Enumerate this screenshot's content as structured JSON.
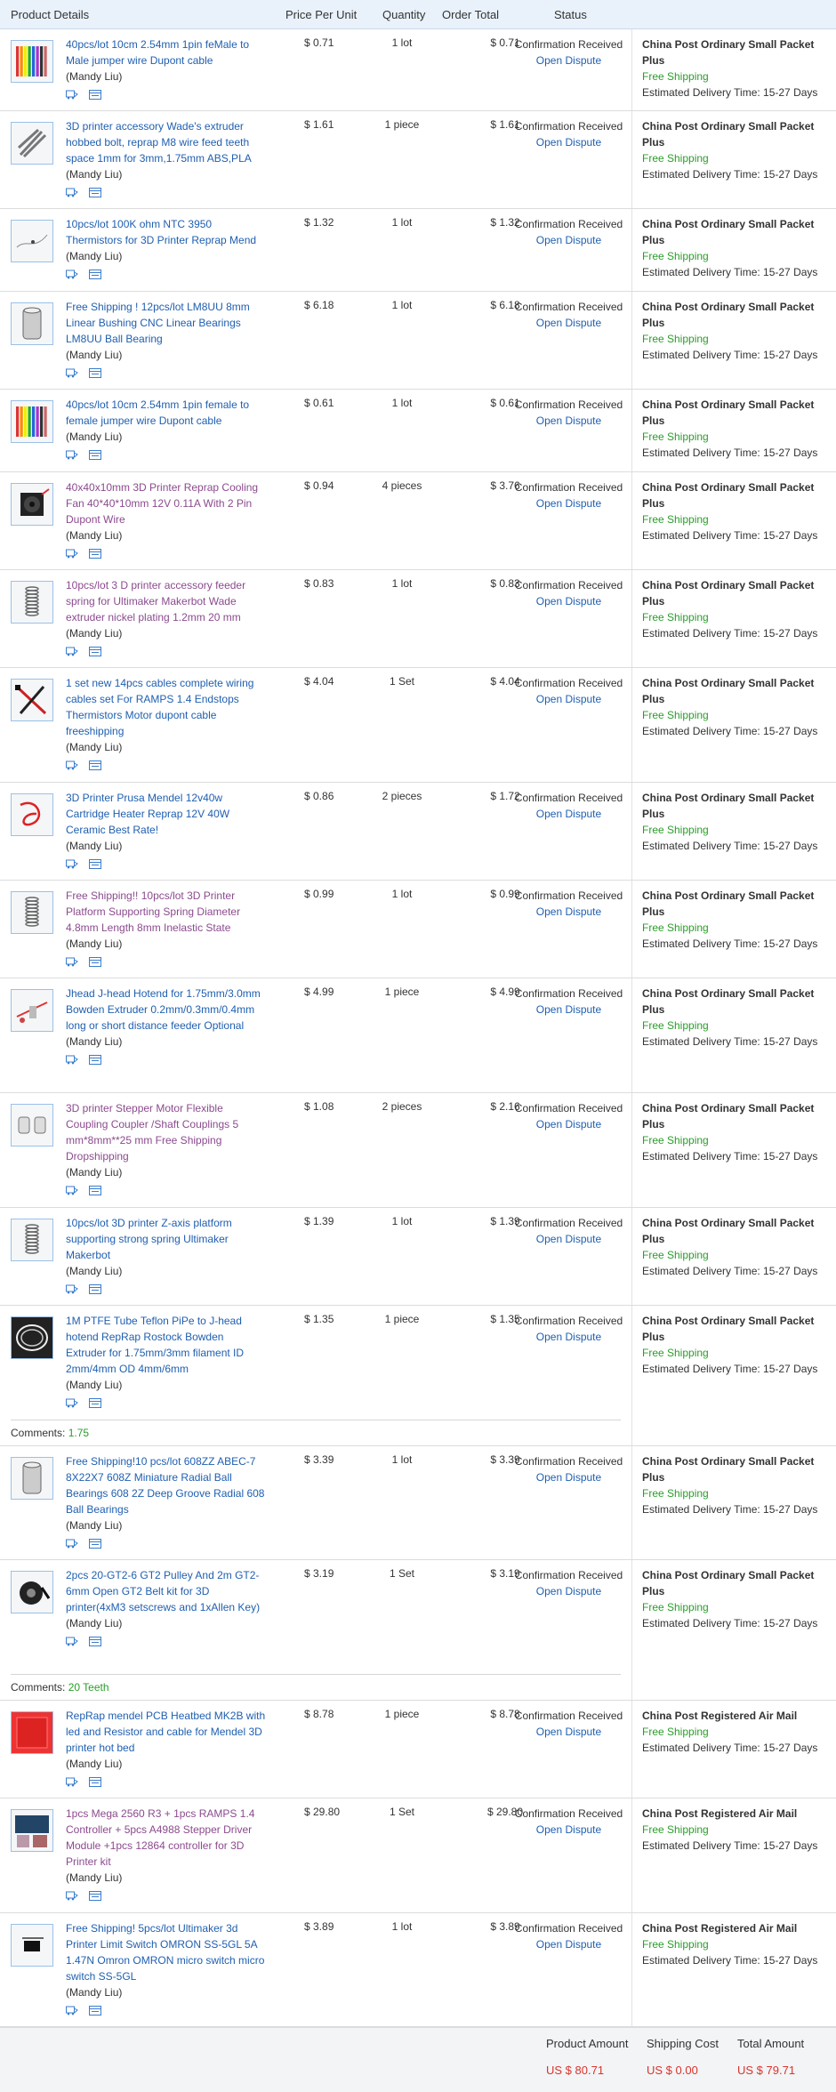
{
  "header": {
    "product_details": "Product Details",
    "price_per_unit": "Price Per Unit",
    "quantity": "Quantity",
    "order_total": "Order Total",
    "status": "Status"
  },
  "orders": [
    {
      "title": "40pcs/lot 10cm 2.54mm 1pin feMale to Male jumper wire Dupont cable",
      "seller": "(Mandy Liu)",
      "price": "$ 0.71",
      "qty": "1 lot",
      "total": "$ 0.71",
      "status": "Confirmation Received",
      "dispute": "Open Dispute",
      "ship_method": "China Post Ordinary Small Packet Plus",
      "ship_cost": "Free Shipping",
      "delivery": "Estimated Delivery Time: 15-27 Days"
    },
    {
      "title": "3D printer accessory Wade's extruder hobbed bolt, reprap M8 wire feed teeth space 1mm for 3mm,1.75mm ABS,PLA",
      "seller": "(Mandy Liu)",
      "price": "$ 1.61",
      "qty": "1 piece",
      "total": "$ 1.61",
      "status": "Confirmation Received",
      "dispute": "Open Dispute",
      "ship_method": "China Post Ordinary Small Packet Plus",
      "ship_cost": "Free Shipping",
      "delivery": "Estimated Delivery Time: 15-27 Days"
    },
    {
      "title": "10pcs/lot 100K ohm NTC 3950 Thermistors for 3D Printer Reprap Mend",
      "seller": "(Mandy Liu)",
      "price": "$ 1.32",
      "qty": "1 lot",
      "total": "$ 1.32",
      "status": "Confirmation Received",
      "dispute": "Open Dispute",
      "ship_method": "China Post Ordinary Small Packet Plus",
      "ship_cost": "Free Shipping",
      "delivery": "Estimated Delivery Time: 15-27 Days"
    },
    {
      "title": "Free Shipping ! 12pcs/lot LM8UU 8mm Linear Bushing CNC Linear Bearings LM8UU Ball Bearing",
      "seller": "(Mandy Liu)",
      "price": "$ 6.18",
      "qty": "1 lot",
      "total": "$ 6.18",
      "status": "Confirmation Received",
      "dispute": "Open Dispute",
      "ship_method": "China Post Ordinary Small Packet Plus",
      "ship_cost": "Free Shipping",
      "delivery": "Estimated Delivery Time: 15-27 Days"
    },
    {
      "title": "40pcs/lot 10cm 2.54mm 1pin female to female jumper wire Dupont cable",
      "seller": "(Mandy Liu)",
      "price": "$ 0.61",
      "qty": "1 lot",
      "total": "$ 0.61",
      "status": "Confirmation Received",
      "dispute": "Open Dispute",
      "ship_method": "China Post Ordinary Small Packet Plus",
      "ship_cost": "Free Shipping",
      "delivery": "Estimated Delivery Time: 15-27 Days"
    },
    {
      "title": "40x40x10mm 3D Printer Reprap Cooling Fan 40*40*10mm 12V 0.11A With 2 Pin Dupont Wire",
      "seller": "(Mandy Liu)",
      "price": "$ 0.94",
      "qty": "4 pieces",
      "total": "$ 3.76",
      "status": "Confirmation Received",
      "dispute": "Open Dispute",
      "ship_method": "China Post Ordinary Small Packet Plus",
      "ship_cost": "Free Shipping",
      "delivery": "Estimated Delivery Time: 15-27 Days"
    },
    {
      "title": "10pcs/lot 3 D printer accessory feeder spring for Ultimaker Makerbot Wade extruder nickel plating 1.2mm 20 mm",
      "seller": "(Mandy Liu)",
      "price": "$ 0.83",
      "qty": "1 lot",
      "total": "$ 0.83",
      "status": "Confirmation Received",
      "dispute": "Open Dispute",
      "ship_method": "China Post Ordinary Small Packet Plus",
      "ship_cost": "Free Shipping",
      "delivery": "Estimated Delivery Time: 15-27 Days"
    },
    {
      "title": "1 set new 14pcs cables complete wiring cables set For RAMPS 1.4 Endstops Thermistors Motor dupont cable freeshipping",
      "seller": "(Mandy Liu)",
      "price": "$ 4.04",
      "qty": "1 Set",
      "total": "$ 4.04",
      "status": "Confirmation Received",
      "dispute": "Open Dispute",
      "ship_method": "China Post Ordinary Small Packet Plus",
      "ship_cost": "Free Shipping",
      "delivery": "Estimated Delivery Time: 15-27 Days"
    },
    {
      "title": "3D Printer Prusa Mendel 12v40w Cartridge Heater Reprap 12V 40W Ceramic Best Rate!",
      "seller": "(Mandy Liu)",
      "price": "$ 0.86",
      "qty": "2 pieces",
      "total": "$ 1.72",
      "status": "Confirmation Received",
      "dispute": "Open Dispute",
      "ship_method": "China Post Ordinary Small Packet Plus",
      "ship_cost": "Free Shipping",
      "delivery": "Estimated Delivery Time: 15-27 Days"
    },
    {
      "title": "Free Shipping!! 10pcs/lot 3D Printer Platform Supporting Spring Diameter 4.8mm Length 8mm Inelastic State",
      "seller": "(Mandy Liu)",
      "price": "$ 0.99",
      "qty": "1 lot",
      "total": "$ 0.99",
      "status": "Confirmation Received",
      "dispute": "Open Dispute",
      "ship_method": "China Post Ordinary Small Packet Plus",
      "ship_cost": "Free Shipping",
      "delivery": "Estimated Delivery Time: 15-27 Days"
    },
    {
      "title": "Jhead J-head Hotend for 1.75mm/3.0mm Bowden Extruder 0.2mm/0.3mm/0.4mm long or short distance feeder Optional",
      "seller": "(Mandy Liu)",
      "price": "$ 4.99",
      "qty": "1 piece",
      "total": "$ 4.99",
      "status": "Confirmation Received",
      "dispute": "Open Dispute",
      "ship_method": "China Post Ordinary Small Packet Plus",
      "ship_cost": "Free Shipping",
      "delivery": "Estimated Delivery Time: 15-27 Days"
    },
    {
      "title": "3D printer Stepper Motor Flexible Coupling Coupler /Shaft Couplings 5 mm*8mm**25 mm Free Shipping Dropshipping",
      "seller": "(Mandy Liu)",
      "price": "$ 1.08",
      "qty": "2 pieces",
      "total": "$ 2.16",
      "status": "Confirmation Received",
      "dispute": "Open Dispute",
      "ship_method": "China Post Ordinary Small Packet Plus",
      "ship_cost": "Free Shipping",
      "delivery": "Estimated Delivery Time: 15-27 Days"
    },
    {
      "title": "10pcs/lot 3D printer Z-axis platform supporting strong spring Ultimaker Makerbot",
      "seller": "(Mandy Liu)",
      "price": "$ 1.39",
      "qty": "1 lot",
      "total": "$ 1.39",
      "status": "Confirmation Received",
      "dispute": "Open Dispute",
      "ship_method": "China Post Ordinary Small Packet Plus",
      "ship_cost": "Free Shipping",
      "delivery": "Estimated Delivery Time: 15-27 Days"
    },
    {
      "title": "1M PTFE Tube Teflon PiPe to J-head hotend RepRap Rostock Bowden Extruder for 1.75mm/3mm filament ID 2mm/4mm OD 4mm/6mm",
      "seller": "(Mandy Liu)",
      "price": "$ 1.35",
      "qty": "1 piece",
      "total": "$ 1.35",
      "status": "Confirmation Received",
      "dispute": "Open Dispute",
      "ship_method": "China Post Ordinary Small Packet Plus",
      "ship_cost": "Free Shipping",
      "delivery": "Estimated Delivery Time: 15-27 Days",
      "comment_label": "Comments:",
      "comment": "1.75"
    },
    {
      "title": "Free Shipping!10 pcs/lot 608ZZ ABEC-7 8X22X7 608Z Miniature Radial Ball Bearings 608 2Z Deep Groove Radial 608 Ball Bearings",
      "seller": "(Mandy Liu)",
      "price": "$ 3.39",
      "qty": "1 lot",
      "total": "$ 3.39",
      "status": "Confirmation Received",
      "dispute": "Open Dispute",
      "ship_method": "China Post Ordinary Small Packet Plus",
      "ship_cost": "Free Shipping",
      "delivery": "Estimated Delivery Time: 15-27 Days"
    },
    {
      "title": "2pcs 20-GT2-6 GT2 Pulley And 2m GT2-6mm Open GT2 Belt kit for 3D printer(4xM3 setscrews and 1xAllen Key)",
      "seller": "(Mandy Liu)",
      "price": "$ 3.19",
      "qty": "1 Set",
      "total": "$ 3.19",
      "status": "Confirmation Received",
      "dispute": "Open Dispute",
      "ship_method": "China Post Ordinary Small Packet Plus",
      "ship_cost": "Free Shipping",
      "delivery": "Estimated Delivery Time: 15-27 Days",
      "comment_label": "Comments:",
      "comment": "20 Teeth"
    },
    {
      "title": "RepRap mendel PCB Heatbed MK2B with led and Resistor and cable for Mendel 3D printer hot bed",
      "seller": "(Mandy Liu)",
      "price": "$ 8.78",
      "qty": "1 piece",
      "total": "$ 8.78",
      "status": "Confirmation Received",
      "dispute": "Open Dispute",
      "ship_method": "China Post Registered Air Mail",
      "ship_cost": "Free Shipping",
      "delivery": "Estimated Delivery Time: 15-27 Days"
    },
    {
      "title": "1pcs Mega 2560 R3 + 1pcs RAMPS 1.4 Controller + 5pcs A4988 Stepper Driver Module +1pcs 12864 controller for 3D Printer kit",
      "seller": "(Mandy Liu)",
      "price": "$ 29.80",
      "qty": "1 Set",
      "total": "$ 29.80",
      "status": "Confirmation Received",
      "dispute": "Open Dispute",
      "ship_method": "China Post Registered Air Mail",
      "ship_cost": "Free Shipping",
      "delivery": "Estimated Delivery Time: 15-27 Days"
    },
    {
      "title": "Free Shipping! 5pcs/lot Ultimaker 3d Printer Limit Switch OMRON SS-5GL 5A 1.47N Omron OMRON micro switch micro switch SS-5GL",
      "seller": "(Mandy Liu)",
      "price": "$ 3.89",
      "qty": "1 lot",
      "total": "$ 3.89",
      "status": "Confirmation Received",
      "dispute": "Open Dispute",
      "ship_method": "China Post Registered Air Mail",
      "ship_cost": "Free Shipping",
      "delivery": "Estimated Delivery Time: 15-27 Days"
    }
  ],
  "summary": {
    "product_amount_label": "Product Amount",
    "shipping_cost_label": "Shipping Cost",
    "total_amount_label": "Total Amount",
    "product_amount": "US $ 80.71",
    "shipping_cost": "US $ 0.00",
    "total_amount": "US $ 79.71"
  },
  "colors": {
    "link": "#1f5fb0",
    "visited_link": "#8b4a8e",
    "free_shipping": "#2a9d2a",
    "amount": "#d9342b",
    "header_bg": "#e9f2fb"
  }
}
